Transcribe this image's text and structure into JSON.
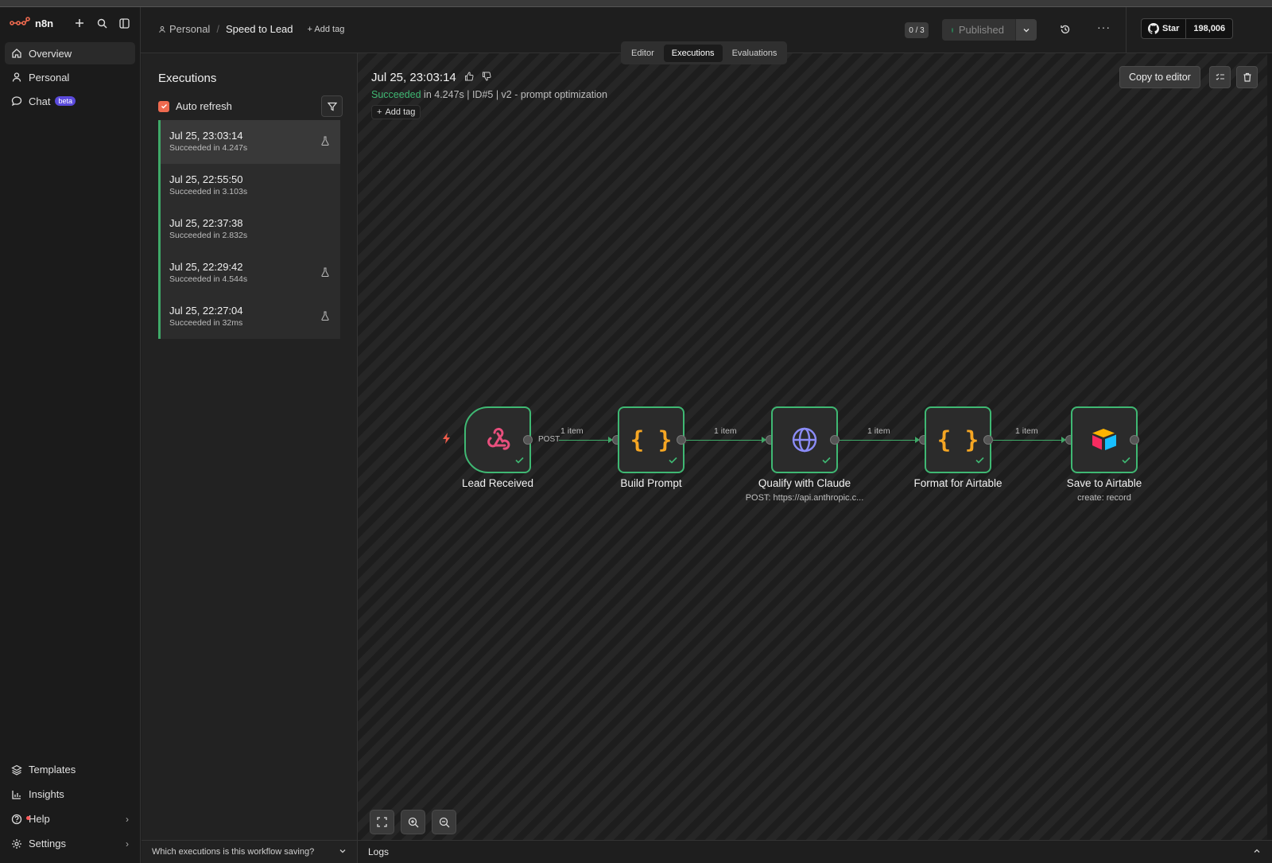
{
  "app": {
    "logo_text": "n8n"
  },
  "sidebar": {
    "items": [
      {
        "label": "Overview",
        "icon": "home-icon"
      },
      {
        "label": "Personal",
        "icon": "user-icon"
      },
      {
        "label": "Chat",
        "icon": "chat-icon",
        "badge": "beta"
      }
    ],
    "bottom": [
      {
        "label": "Templates",
        "icon": "templates-icon"
      },
      {
        "label": "Insights",
        "icon": "insights-icon"
      },
      {
        "label": "Help",
        "icon": "help-icon"
      },
      {
        "label": "Settings",
        "icon": "settings-icon"
      }
    ]
  },
  "header": {
    "project": "Personal",
    "workflow_name": "Speed to Lead",
    "add_tag": "+ Add tag",
    "exec_counter": "0 / 3",
    "publish_label": "Published",
    "github_star": "Star",
    "github_count": "198,006"
  },
  "tabs": [
    {
      "label": "Editor",
      "active": false
    },
    {
      "label": "Executions",
      "active": true
    },
    {
      "label": "Evaluations",
      "active": false
    }
  ],
  "executions": {
    "title": "Executions",
    "auto_refresh_label": "Auto refresh",
    "auto_refresh_checked": true,
    "items": [
      {
        "time": "Jul 25, 23:03:14",
        "status": "Succeeded in 4.247s",
        "flask": true,
        "selected": true
      },
      {
        "time": "Jul 25, 22:55:50",
        "status": "Succeeded in 3.103s",
        "flask": false,
        "selected": false
      },
      {
        "time": "Jul 25, 22:37:38",
        "status": "Succeeded in 2.832s",
        "flask": false,
        "selected": false
      },
      {
        "time": "Jul 25, 22:29:42",
        "status": "Succeeded in 4.544s",
        "flask": true,
        "selected": false
      },
      {
        "time": "Jul 25, 22:27:04",
        "status": "Succeeded in 32ms",
        "flask": true,
        "selected": false
      }
    ],
    "footer_question": "Which executions is this workflow saving?"
  },
  "detail": {
    "title": "Jul 25, 23:03:14",
    "status": "Succeeded",
    "meta_rest": " in 4.247s | ID#5 | v2 - prompt optimization",
    "add_tag": "Add tag",
    "copy_to_editor": "Copy to editor"
  },
  "workflow": {
    "nodes": [
      {
        "name": "Lead Received",
        "subtitle": "",
        "icon": "webhook-icon"
      },
      {
        "name": "Build Prompt",
        "subtitle": "",
        "icon": "code-braces-icon"
      },
      {
        "name": "Qualify with Claude",
        "subtitle": "POST: https://api.anthropic.c...",
        "icon": "globe-icon"
      },
      {
        "name": "Format for Airtable",
        "subtitle": "",
        "icon": "code-braces-icon"
      },
      {
        "name": "Save to Airtable",
        "subtitle": "create: record",
        "icon": "airtable-icon"
      }
    ],
    "connections": [
      {
        "label": "1 item"
      },
      {
        "label": "1 item"
      },
      {
        "label": "1 item"
      },
      {
        "label": "1 item"
      }
    ],
    "webhook_method": "POST"
  },
  "logs": {
    "label": "Logs"
  },
  "colors": {
    "success": "#3fb873",
    "accent": "#ee6a4f",
    "beta_badge": "#5b4bdc"
  }
}
